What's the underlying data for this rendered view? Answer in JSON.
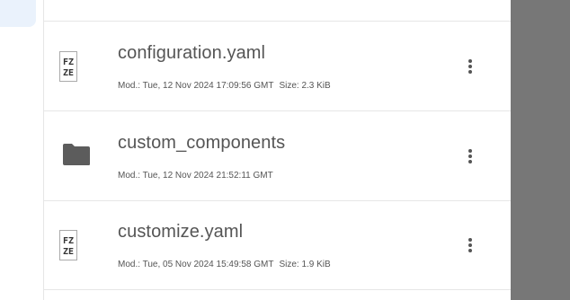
{
  "files": [
    {
      "name": "configuration.yaml",
      "type": "file",
      "icon": "yaml-file-icon",
      "modified": "Mod.: Tue, 12 Nov 2024 17:09:56 GMT",
      "size": "Size: 2.3 KiB"
    },
    {
      "name": "custom_components",
      "type": "folder",
      "icon": "folder-icon",
      "modified": "Mod.: Tue, 12 Nov 2024 21:52:11 GMT",
      "size": ""
    },
    {
      "name": "customize.yaml",
      "type": "file",
      "icon": "yaml-file-icon",
      "modified": "Mod.: Tue, 05 Nov 2024 15:49:58 GMT",
      "size": "Size: 1.9 KiB"
    }
  ],
  "colors": {
    "text": "#555555",
    "divider": "#e6e6e6",
    "overlay": "#777777",
    "selected_tab": "#eaf2fc"
  }
}
